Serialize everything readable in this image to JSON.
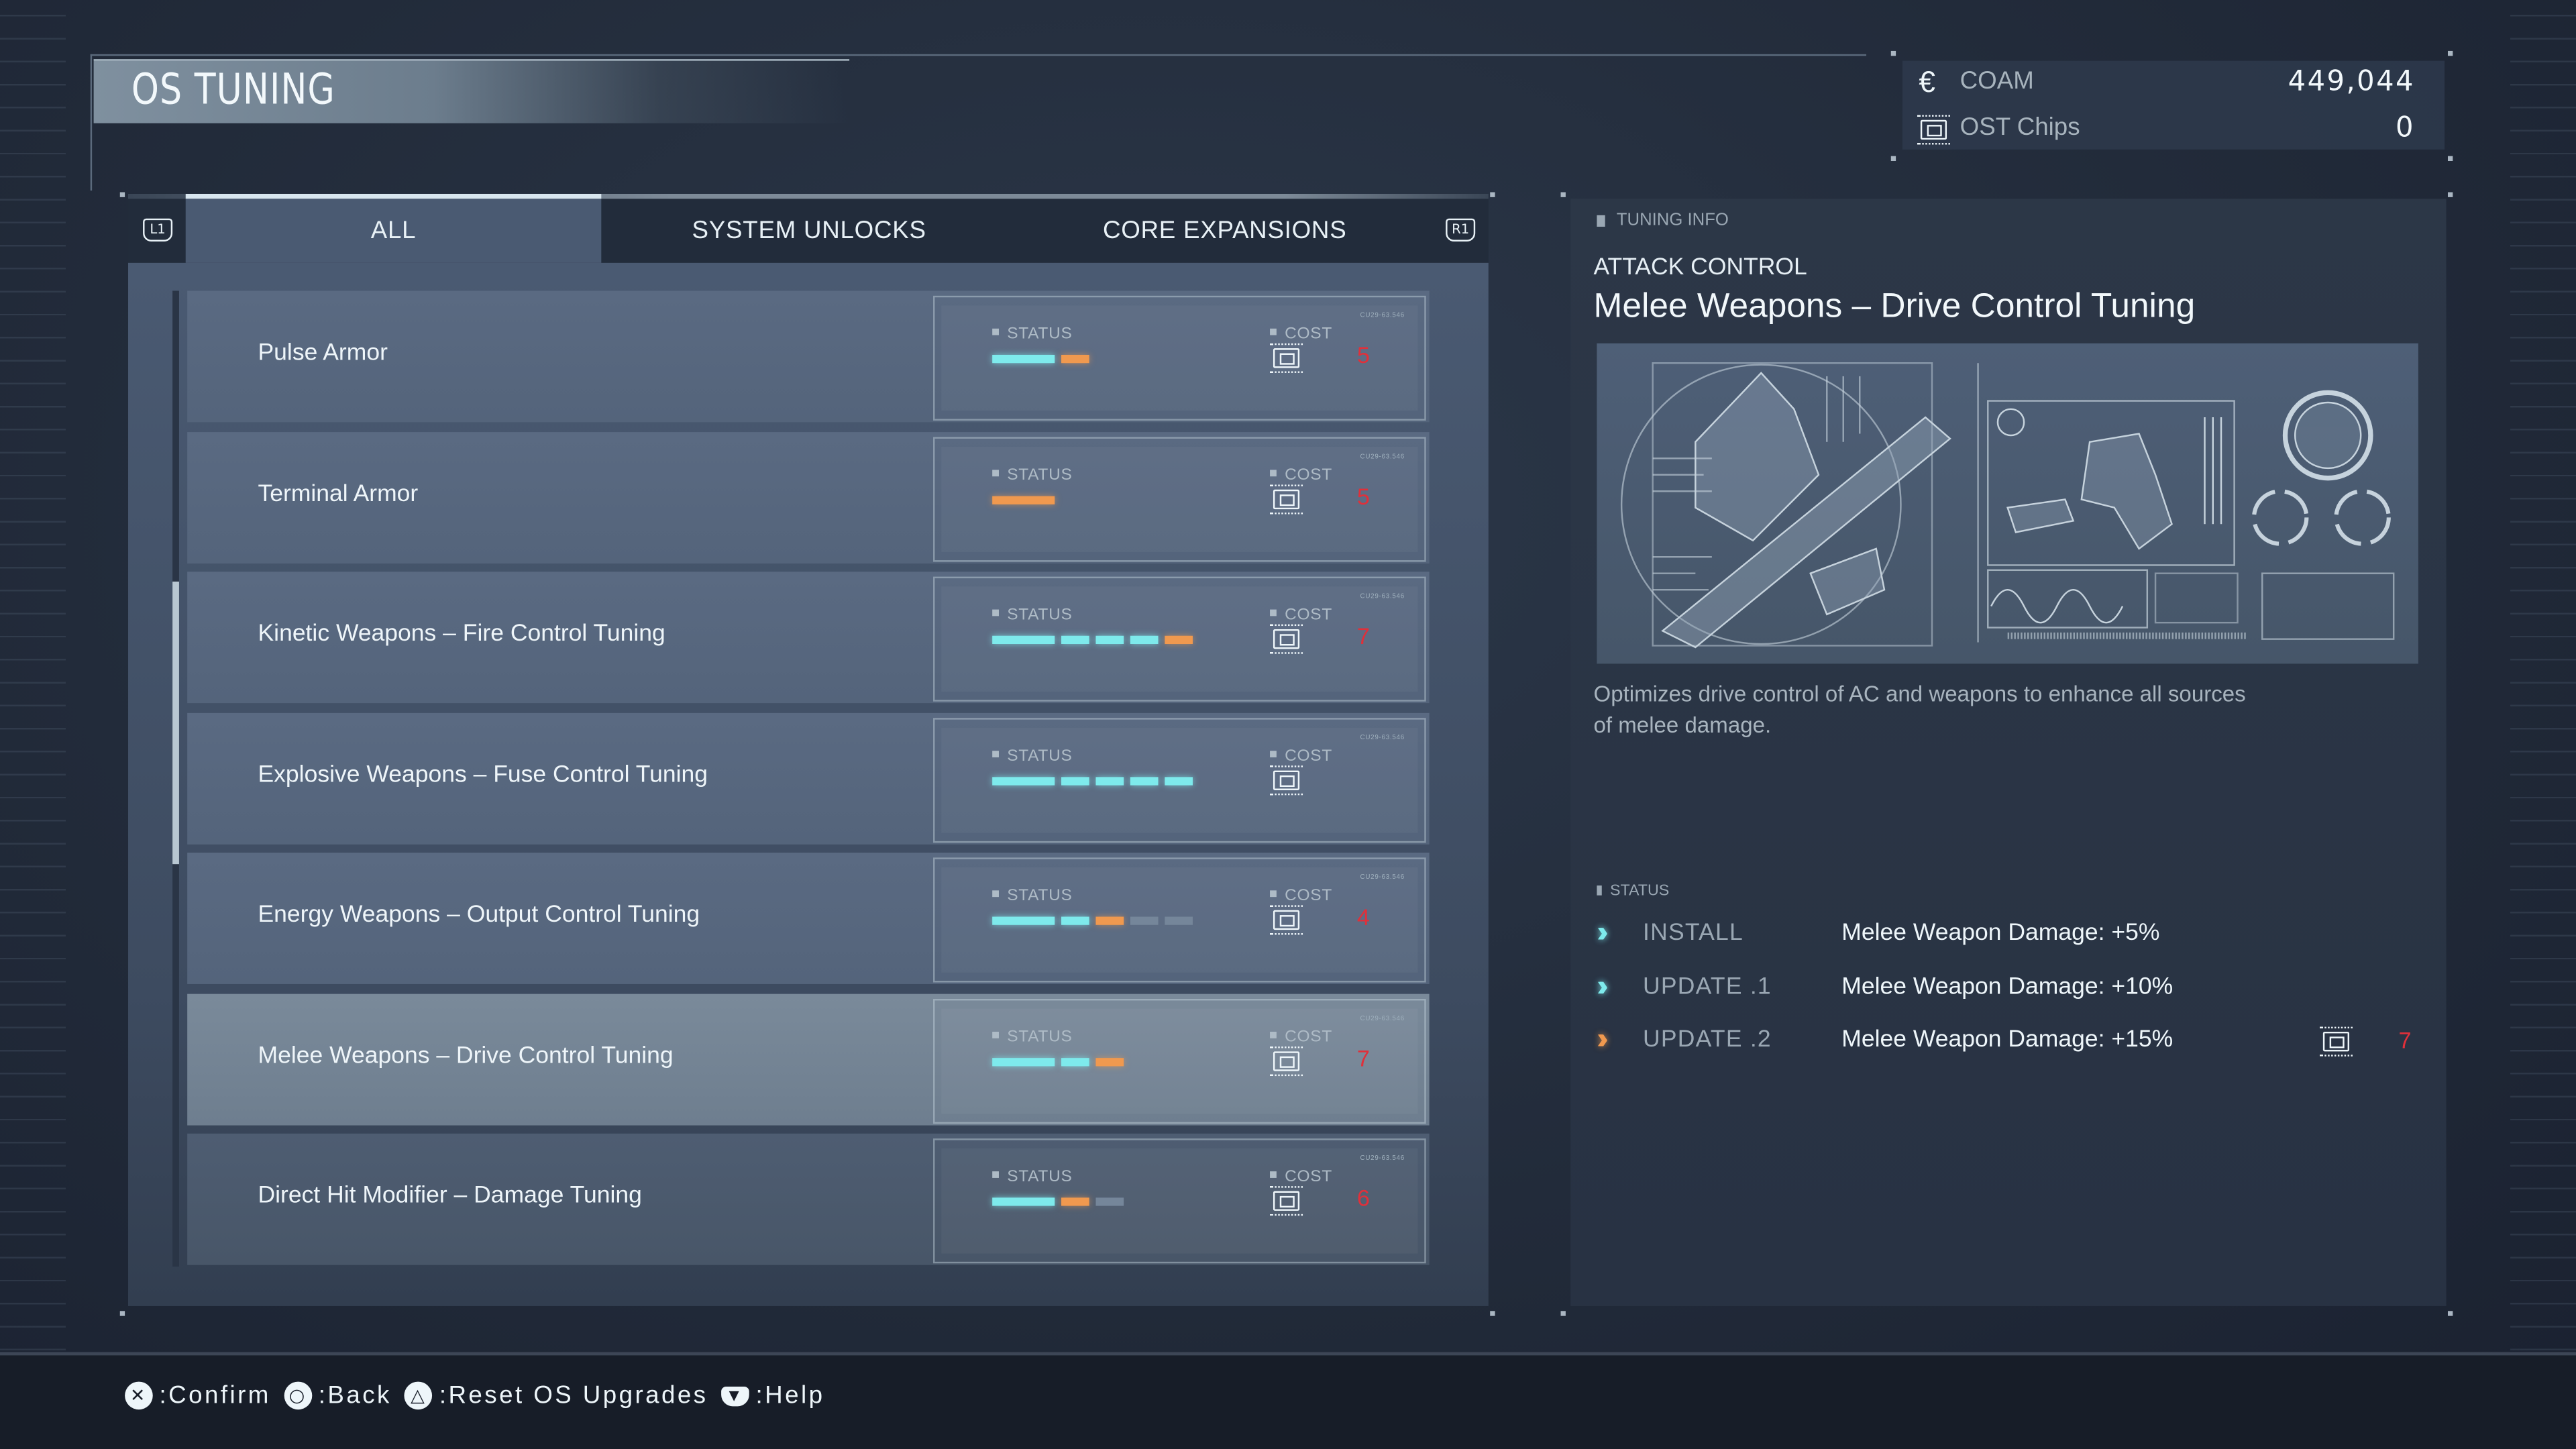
{
  "header": {
    "title": "OS TUNING"
  },
  "currency": [
    {
      "icon": "coam-icon",
      "glyph": "€",
      "label": "COAM",
      "value": "449,044"
    },
    {
      "icon": "ost-chip-icon",
      "label": "OST Chips",
      "value": "0"
    }
  ],
  "tabs": {
    "left_shoulder": "L1",
    "right_shoulder": "R1",
    "items": [
      {
        "label": "ALL",
        "active": true
      },
      {
        "label": "SYSTEM UNLOCKS",
        "active": false
      },
      {
        "label": "CORE EXPANSIONS",
        "active": false
      }
    ]
  },
  "list": {
    "status_label": "STATUS",
    "cost_label": "COST",
    "card_code": "CU29-63.546",
    "items": [
      {
        "name": "Pulse Armor",
        "status": [
          "on",
          "next"
        ],
        "cost": "5",
        "selected": false
      },
      {
        "name": "Terminal Armor",
        "status": [
          "next"
        ],
        "cost": "5",
        "selected": false
      },
      {
        "name": "Kinetic Weapons – Fire Control Tuning",
        "status": [
          "on",
          "on",
          "on",
          "on",
          "next"
        ],
        "cost": "7",
        "selected": false
      },
      {
        "name": "Explosive Weapons – Fuse Control Tuning",
        "status": [
          "on",
          "on",
          "on",
          "on",
          "on"
        ],
        "cost": "",
        "selected": false
      },
      {
        "name": "Energy Weapons – Output Control Tuning",
        "status": [
          "on",
          "on",
          "next",
          "off",
          "off"
        ],
        "cost": "4",
        "selected": false
      },
      {
        "name": "Melee Weapons – Drive Control Tuning",
        "status": [
          "on",
          "on",
          "next"
        ],
        "cost": "7",
        "selected": true
      },
      {
        "name": "Direct Hit Modifier – Damage Tuning",
        "status": [
          "on",
          "next",
          "off"
        ],
        "cost": "6",
        "selected": false
      }
    ],
    "scroll": {
      "position_fraction": 0.42,
      "visible_fraction": 0.29
    }
  },
  "detail": {
    "section_label": "TUNING INFO",
    "category": "ATTACK CONTROL",
    "title": "Melee Weapons – Drive Control Tuning",
    "description": "Optimizes drive control of AC and weapons to enhance all sources of melee damage.",
    "status_label": "STATUS",
    "stages": [
      {
        "name": "INSTALL",
        "effect": "Melee Weapon Damage: +5%",
        "state": "done",
        "cost": ""
      },
      {
        "name": "UPDATE .1",
        "effect": "Melee Weapon Damage: +10%",
        "state": "done",
        "cost": ""
      },
      {
        "name": "UPDATE .2",
        "effect": "Melee Weapon Damage: +15%",
        "state": "next",
        "cost": "7"
      }
    ]
  },
  "footer": {
    "hints": [
      {
        "button": "✕",
        "icon": "cross-button-icon",
        "label": ":Confirm"
      },
      {
        "button": "○",
        "icon": "circle-button-icon",
        "label": ":Back"
      },
      {
        "button": "△",
        "icon": "triangle-button-icon",
        "label": ":Reset OS Upgrades"
      },
      {
        "button": "▼",
        "icon": "touchpad-button-icon",
        "label": ":Help"
      }
    ]
  },
  "colors": {
    "installed": "#7eeaec",
    "next_upgrade": "#f0994f",
    "locked": "#75869a",
    "cost": "#e0303a"
  }
}
